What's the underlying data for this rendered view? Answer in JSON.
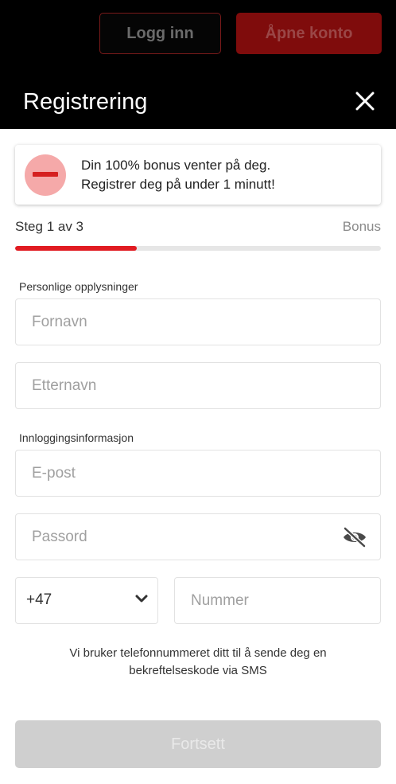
{
  "topbar": {
    "login_label": "Logg inn",
    "open_account_label": "Åpne konto"
  },
  "modal": {
    "title": "Registrering",
    "close_icon": "close-icon"
  },
  "bonus": {
    "line1": "Din 100% bonus venter på deg.",
    "line2": "Registrer deg på under 1 minutt!"
  },
  "progress": {
    "step_label": "Steg 1 av 3",
    "right_label": "Bonus",
    "fraction": 0.333
  },
  "personal": {
    "section_label": "Personlige opplysninger",
    "first_name_placeholder": "Fornavn",
    "last_name_placeholder": "Etternavn"
  },
  "login_info": {
    "section_label": "Innloggingsinformasjon",
    "email_placeholder": "E-post",
    "password_placeholder": "Passord",
    "password_icon": "eye-slash-icon"
  },
  "phone": {
    "country_code": "+47",
    "number_placeholder": "Nummer",
    "note_line1": "Vi bruker telefonnummeret ditt til å sende deg en",
    "note_line2": "bekreftelseskode via SMS"
  },
  "continue_label": "Fortsett",
  "colors": {
    "accent": "#e11b22",
    "header_bg": "#000000",
    "disabled_button": "#cfcfcf"
  }
}
